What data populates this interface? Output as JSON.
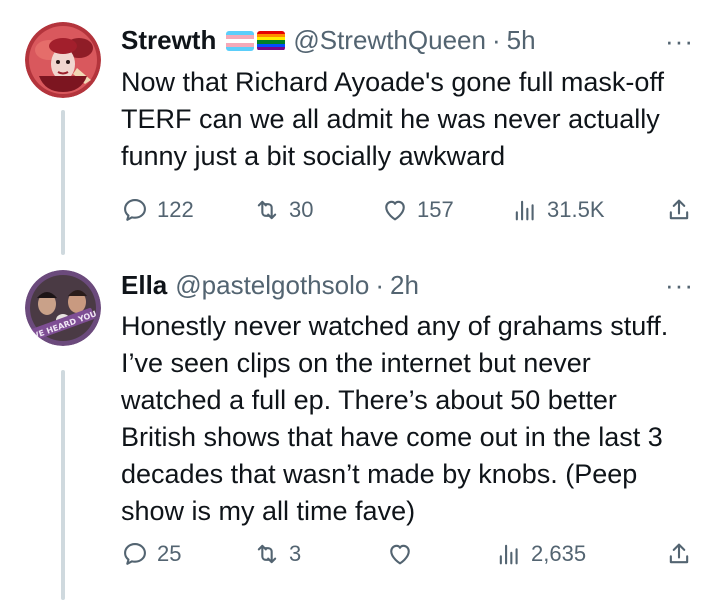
{
  "tweets": [
    {
      "name": "Strewth",
      "handle": "@StrewthQueen",
      "separator": "·",
      "time": "5h",
      "text": "Now that Richard Ayoade's gone full mask-off\nTERF can we all admit he was never actually\nfunny just a bit socially awkward",
      "replies": "122",
      "retweets": "30",
      "likes": "157",
      "views": "31.5K",
      "flags": [
        "transgender-flag",
        "rainbow-pride-flag"
      ],
      "more": "···"
    },
    {
      "name": "Ella",
      "handle": "@pastelgothsolo",
      "separator": "·",
      "time": "2h",
      "text": "Honestly never watched any of grahams stuff.\nI’ve seen clips on the internet but never\nwatched a full ep. There’s about 50 better\nBritish shows that have come out in the last 3\ndecades that wasn’t made by knobs. (Peep\nshow is my all time fave)",
      "replies": "25",
      "retweets": "3",
      "likes": "",
      "views": "2,635",
      "avatar_banner": "WE HEARD YOU",
      "more": "···"
    }
  ],
  "colors": {
    "text": "#0f1419",
    "secondary": "#536471",
    "thread_line": "#cfd9de"
  }
}
